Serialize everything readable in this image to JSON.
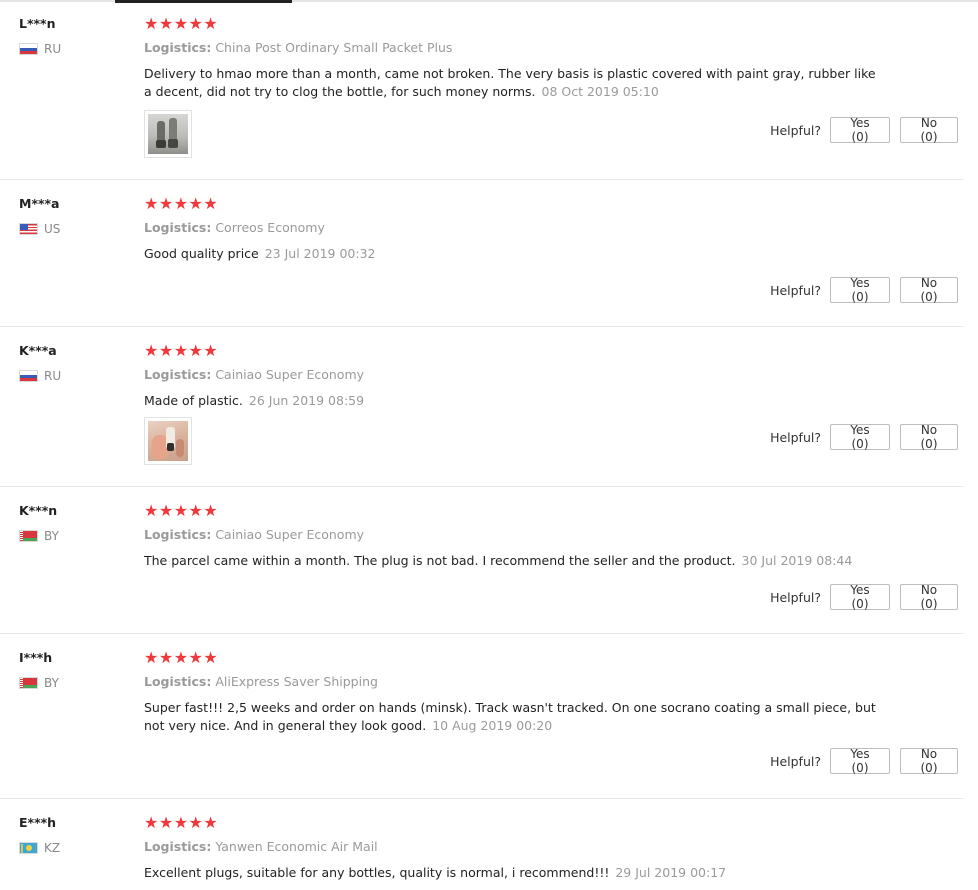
{
  "reviews": [
    {
      "user": "L***n",
      "country": "RU",
      "flag": "ru",
      "stars": "★★★★★",
      "logistics_label": "Logistics:",
      "logistics": "China Post Ordinary Small Packet Plus",
      "text": "Delivery to hmao more than a month, came not broken. The very basis is plastic covered with paint gray, rubber like a decent, did not try to clog the bottle, for such money norms.",
      "date": "08 Oct 2019 05:10",
      "has_photo": true,
      "helpful_label": "Helpful?",
      "yes_label": "Yes (0)",
      "no_label": "No (0)"
    },
    {
      "user": "M***a",
      "country": "US",
      "flag": "us",
      "stars": "★★★★★",
      "logistics_label": "Logistics:",
      "logistics": "Correos Economy",
      "text": "Good quality price",
      "date": "23 Jul 2019 00:32",
      "has_photo": false,
      "helpful_label": "Helpful?",
      "yes_label": "Yes (0)",
      "no_label": "No (0)"
    },
    {
      "user": "K***a",
      "country": "RU",
      "flag": "ru",
      "stars": "★★★★★",
      "logistics_label": "Logistics:",
      "logistics": "Cainiao Super Economy",
      "text": "Made of plastic.",
      "date": "26 Jun 2019 08:59",
      "has_photo": true,
      "helpful_label": "Helpful?",
      "yes_label": "Yes (0)",
      "no_label": "No (0)"
    },
    {
      "user": "K***n",
      "country": "BY",
      "flag": "by",
      "stars": "★★★★★",
      "logistics_label": "Logistics:",
      "logistics": "Cainiao Super Economy",
      "text": "The parcel came within a month. The plug is not bad. I recommend the seller and the product.",
      "date": "30 Jul 2019 08:44",
      "has_photo": false,
      "helpful_label": "Helpful?",
      "yes_label": "Yes (0)",
      "no_label": "No (0)"
    },
    {
      "user": "I***h",
      "country": "BY",
      "flag": "by",
      "stars": "★★★★★",
      "logistics_label": "Logistics:",
      "logistics": "AliExpress Saver Shipping",
      "text": "Super fast!!! 2,5 weeks and order on hands (minsk). Track wasn't tracked. On one socrano coating a small piece, but not very nice. And in general they look good.",
      "date": "10 Aug 2019 00:20",
      "has_photo": false,
      "helpful_label": "Helpful?",
      "yes_label": "Yes (0)",
      "no_label": "No (0)"
    },
    {
      "user": "E***h",
      "country": "KZ",
      "flag": "kz",
      "stars": "★★★★★",
      "logistics_label": "Logistics:",
      "logistics": "Yanwen Economic Air Mail",
      "text": "Excellent plugs, suitable for any bottles, quality is normal, i recommend!!!",
      "date": "29 Jul 2019 00:17",
      "has_photo": false
    }
  ],
  "colors": {
    "star": "#f0393c",
    "muted_text": "#9a9a9a",
    "divider": "#e8e8e8"
  }
}
